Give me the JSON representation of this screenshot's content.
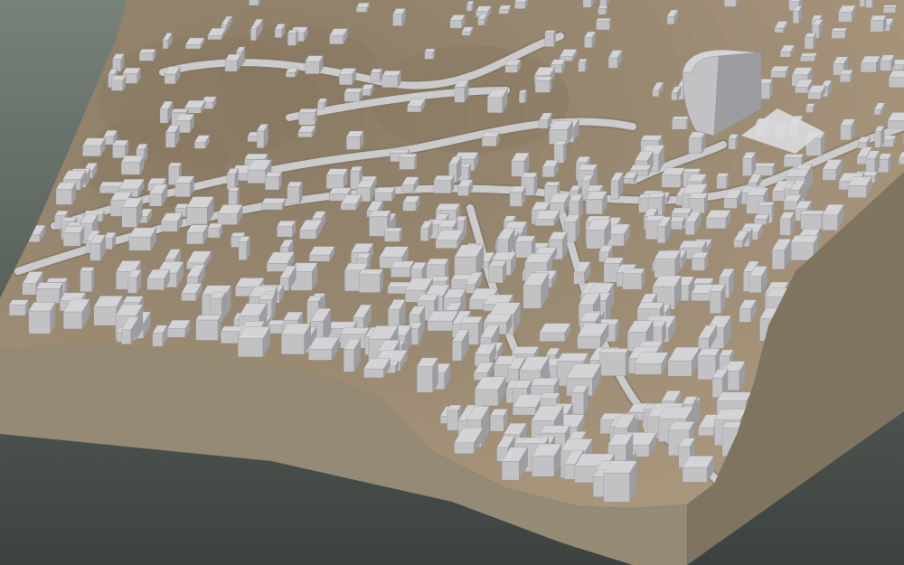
{
  "scene": {
    "kind": "3d-city-terrain-model",
    "colors": {
      "background_top": "#778279",
      "background_bottom": "#3c423f",
      "terrain": "#a8967c",
      "terrain_dark": "#8a7860",
      "base_front": "#948a76",
      "base_side": "#7e745f",
      "building_top": "#d4d4d6",
      "building_side_light": "#c2c2c5",
      "building_side_dark": "#9d9da1",
      "road": "#cbcbcd"
    },
    "building_count": 520,
    "road_count": 7
  }
}
